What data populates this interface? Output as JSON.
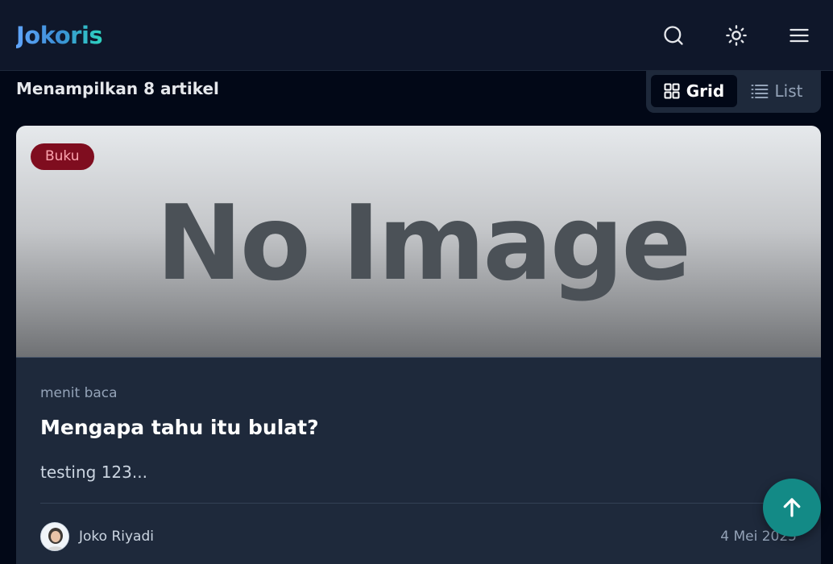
{
  "header": {
    "brand": "Jokoris",
    "icons": [
      "search-icon",
      "sun-icon",
      "menu-icon"
    ]
  },
  "toolbar": {
    "count_text": "Menampilkan 8 artikel",
    "view_grid_label": "Grid",
    "view_list_label": "List",
    "active_view": "Grid"
  },
  "article": {
    "category": "Buku",
    "image_placeholder": "No Image",
    "read_time": "menit baca",
    "title": "Mengapa tahu itu bulat?",
    "excerpt": "testing 123...",
    "author": "Joko Riyadi",
    "date": "4 Mei 2025"
  },
  "colors": {
    "background": "#020817",
    "header": "#0f172a",
    "card": "#1e293b",
    "badge_bg": "#7f0d1f",
    "badge_text": "#fda4af",
    "accent_button": "#138a86"
  },
  "floating": {
    "icon": "arrow-up-icon"
  }
}
